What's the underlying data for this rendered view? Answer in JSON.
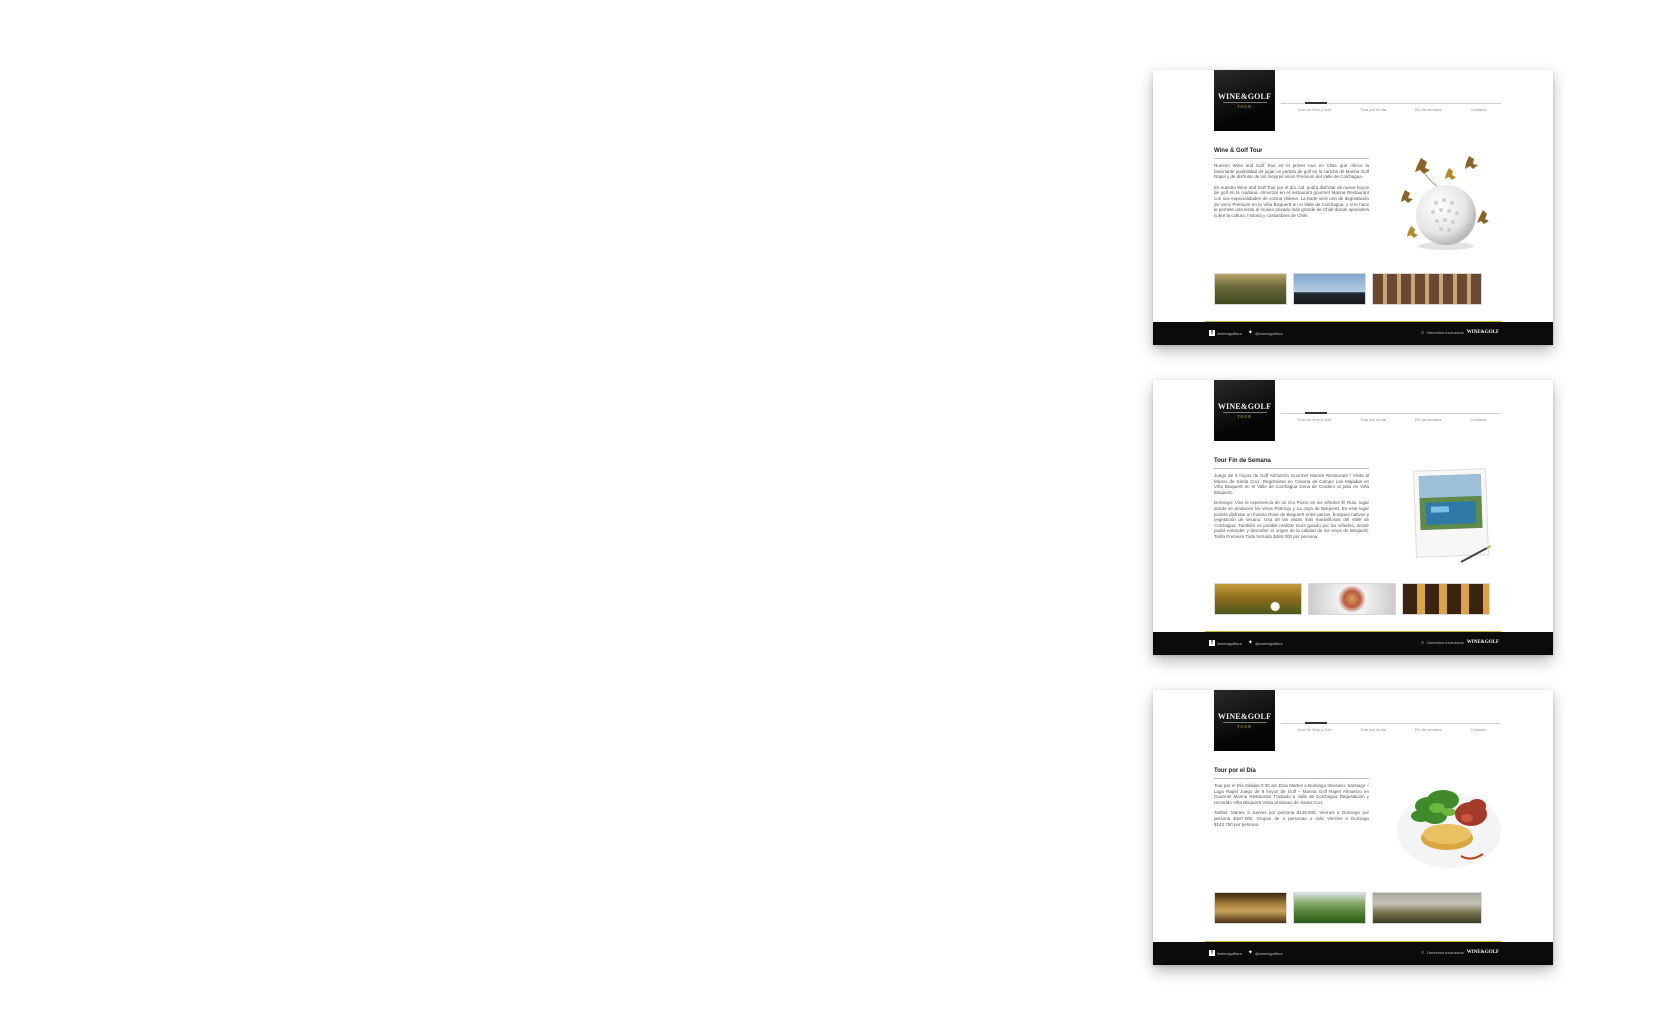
{
  "brand": {
    "name": "WINE&GOLF",
    "tagline": "TOUR"
  },
  "nav": [
    "Tour de Vino y Golf",
    "Tour por el día",
    "Fin de semana",
    "Contacto"
  ],
  "footer": {
    "facebook": "/winedgolftour",
    "twitter": "@winedgolftour",
    "copyright": "Derechos exclusivos",
    "logo": "WINE&GOLF"
  },
  "pages": [
    {
      "title": "Wine & Golf Tour",
      "paragraphs": [
        "Nuestro Wine and Golf Tour es el primer tour en Chile que ofrece la fascinante posibilidad de jugar un partido de golf en la cancha de Marina Golf Rapel y de disfrutar de los mejores vinos Premium del Valle de Colchagua.",
        "En nuestro Wine and Golf Tour por el día, Ud. podrá disfrutar de nueve hoyos de golf en la mañana. Almorzar en el restaurant gourmet Marina Restaurant con sus especialidades de cocina chilena. La tarde será una de degustación de vinos Premium en la Viña Bisquertt en el Valle de Colchagua, y si le hace le permite una visita al museo privado más grande de Chile donde aprenderá sobre la cultura, historia y costumbres de Chile."
      ],
      "hero_icon": "golf-ball-leaves-image",
      "thumbs": [
        "vineyard-photo",
        "golfer-silhouette-photo",
        "estate-corridor-photo"
      ]
    },
    {
      "title": "Tour Fin de Semana",
      "paragraphs": [
        "Juego de 9 hoyos de Golf Almuerzo Gourmet Marina Restaurant / Visita al Museo de Santa Cruz. Registrarse en Casona de Campo Las Majadas en Viña Bisquertt en el Valle de Colchagua Cena de Cordero al palo en Viña Bisquertt.",
        "Domingo: Vive la experiencia de un rico Picnic en los viñedos El Rulo, lugar donde se producen los vinos Petirrojo y La Joya de Bisquertt. En este lugar podrás disfrutar un frutoso Rose de Bisquertt entre parras, bosques nativos y vegetación de secano. Una de las vistas más maravillosas del Valle de Colchagua. También es posible realizar tours guiado por los viñedos, donde podrá entender y descubrir el origen de la calidad de los vinos de Bisquertt. Tarifa Premium Todo Incluido $484.000 por persona."
      ],
      "hero_icon": "pool-polaroid-image",
      "thumbs": [
        "golf-ball-photo",
        "gourmet-plate-photo",
        "wine-glasses-photo"
      ]
    },
    {
      "title": "Tour por el Día",
      "paragraphs": [
        "Tour por el Día Salidas 8:30 am Días Martes a Domingo Itinerario: Santiago – Lago Rapel Juego de 9 hoyos de Golf – Marina Golf Rapel Almuerzo en Gourmet Marina Restaurant Traslado a Valle de Colchagua Degustación y recorrido Viña Bisquertt Visita al Museo de Santa Cruz.",
        "Tarifas: Martes a Jueves por persona $145.000. Viernes a Domingo por persona $187.500. Grupos de 4 personas o más Viernes a Domingo $143.750 por persona."
      ],
      "hero_icon": "gourmet-dish-image",
      "thumbs": [
        "wine-cellar-photo",
        "green-valley-photo",
        "countryside-photo"
      ]
    }
  ]
}
